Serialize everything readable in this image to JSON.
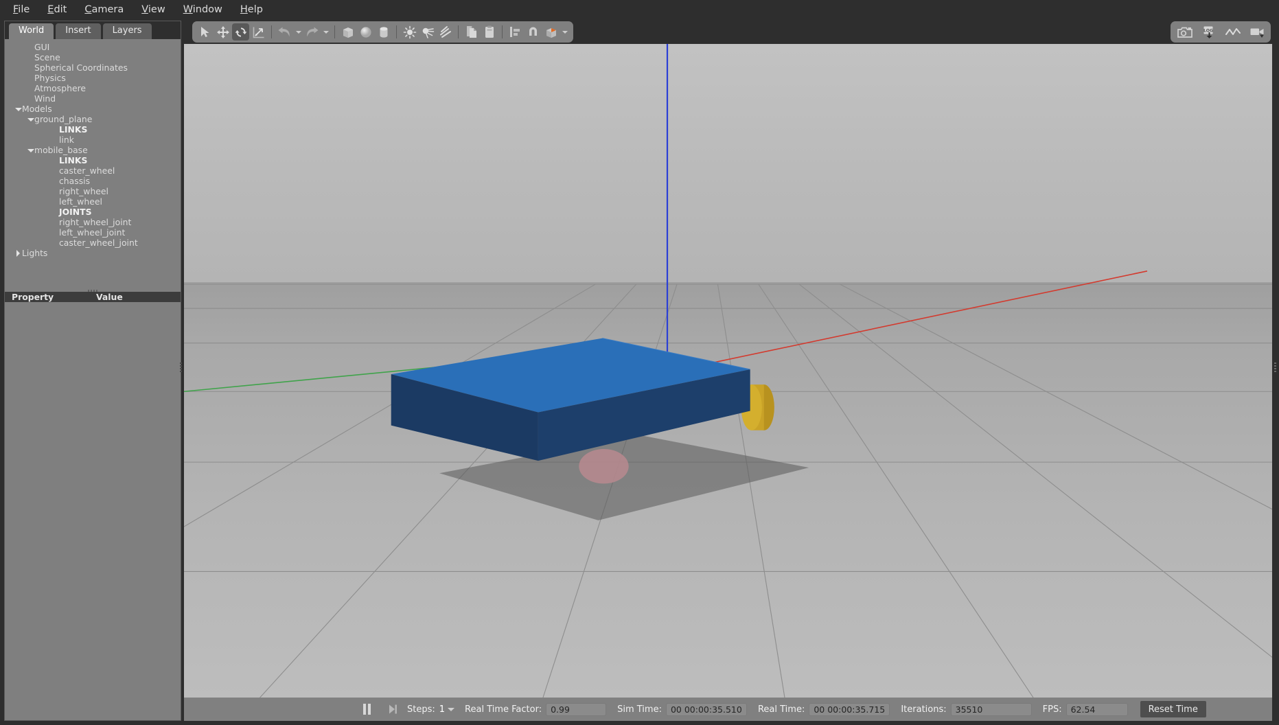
{
  "menu": {
    "items": [
      {
        "label": "File",
        "mnemonic": "F"
      },
      {
        "label": "Edit",
        "mnemonic": "E"
      },
      {
        "label": "Camera",
        "mnemonic": "C"
      },
      {
        "label": "View",
        "mnemonic": "V"
      },
      {
        "label": "Window",
        "mnemonic": "W"
      },
      {
        "label": "Help",
        "mnemonic": "H"
      }
    ]
  },
  "left_panel": {
    "tabs": [
      {
        "label": "World",
        "active": true
      },
      {
        "label": "Insert",
        "active": false
      },
      {
        "label": "Layers",
        "active": false
      }
    ],
    "tree": [
      {
        "label": "GUI",
        "indent": 1,
        "caret": "none",
        "bold": false
      },
      {
        "label": "Scene",
        "indent": 1,
        "caret": "none",
        "bold": false
      },
      {
        "label": "Spherical Coordinates",
        "indent": 1,
        "caret": "none",
        "bold": false
      },
      {
        "label": "Physics",
        "indent": 1,
        "caret": "none",
        "bold": false
      },
      {
        "label": "Atmosphere",
        "indent": 1,
        "caret": "none",
        "bold": false
      },
      {
        "label": "Wind",
        "indent": 1,
        "caret": "none",
        "bold": false
      },
      {
        "label": "Models",
        "indent": 0,
        "caret": "down",
        "bold": false
      },
      {
        "label": "ground_plane",
        "indent": 1,
        "caret": "down",
        "bold": false
      },
      {
        "label": "LINKS",
        "indent": 3,
        "caret": "none",
        "bold": true
      },
      {
        "label": "link",
        "indent": 3,
        "caret": "none",
        "bold": false
      },
      {
        "label": "mobile_base",
        "indent": 1,
        "caret": "down",
        "bold": false
      },
      {
        "label": "LINKS",
        "indent": 3,
        "caret": "none",
        "bold": true
      },
      {
        "label": "caster_wheel",
        "indent": 3,
        "caret": "none",
        "bold": false
      },
      {
        "label": "chassis",
        "indent": 3,
        "caret": "none",
        "bold": false
      },
      {
        "label": "right_wheel",
        "indent": 3,
        "caret": "none",
        "bold": false
      },
      {
        "label": "left_wheel",
        "indent": 3,
        "caret": "none",
        "bold": false
      },
      {
        "label": "JOINTS",
        "indent": 3,
        "caret": "none",
        "bold": true
      },
      {
        "label": "right_wheel_joint",
        "indent": 3,
        "caret": "none",
        "bold": false
      },
      {
        "label": "left_wheel_joint",
        "indent": 3,
        "caret": "none",
        "bold": false
      },
      {
        "label": "caster_wheel_joint",
        "indent": 3,
        "caret": "none",
        "bold": false
      },
      {
        "label": "Lights",
        "indent": 0,
        "caret": "right",
        "bold": false
      }
    ],
    "property_header": {
      "col1": "Property",
      "col2": "Value"
    }
  },
  "toolbar": {
    "left_tools": [
      {
        "name": "select-mode",
        "icon": "cursor-arrow-icon",
        "active": false
      },
      {
        "name": "translate-mode",
        "icon": "translate-arrows-icon",
        "active": false
      },
      {
        "name": "rotate-mode",
        "icon": "rotate-arrows-icon",
        "active": true
      },
      {
        "name": "scale-mode",
        "icon": "scale-arrows-icon",
        "active": false
      }
    ],
    "history_tools": [
      {
        "name": "undo-button",
        "icon": "undo-arrow-icon"
      },
      {
        "name": "undo-dropdown",
        "icon": "chevron-down-icon"
      },
      {
        "name": "redo-button",
        "icon": "redo-arrow-icon"
      },
      {
        "name": "redo-dropdown",
        "icon": "chevron-down-icon"
      }
    ],
    "shape_tools": [
      {
        "name": "insert-box",
        "icon": "box-icon"
      },
      {
        "name": "insert-sphere",
        "icon": "sphere-icon"
      },
      {
        "name": "insert-cylinder",
        "icon": "cylinder-icon"
      }
    ],
    "light_tools": [
      {
        "name": "insert-point-light",
        "icon": "point-light-icon"
      },
      {
        "name": "insert-spot-light",
        "icon": "spot-light-icon"
      },
      {
        "name": "insert-directional-light",
        "icon": "directional-light-icon"
      }
    ],
    "clipboard_tools": [
      {
        "name": "copy-button",
        "icon": "copy-icon"
      },
      {
        "name": "paste-button",
        "icon": "paste-icon"
      }
    ],
    "align_tools": [
      {
        "name": "align-button",
        "icon": "align-icon"
      },
      {
        "name": "snap-button",
        "icon": "magnet-snap-icon"
      },
      {
        "name": "view-angle-button",
        "icon": "view-cube-icon"
      },
      {
        "name": "view-angle-dropdown",
        "icon": "chevron-down-icon"
      }
    ],
    "right_tools": [
      {
        "name": "screenshot-button",
        "icon": "camera-icon"
      },
      {
        "name": "log-button",
        "icon": "log-download-icon"
      },
      {
        "name": "plot-button",
        "icon": "line-chart-icon"
      },
      {
        "name": "video-record-button",
        "icon": "video-camera-icon"
      }
    ]
  },
  "statusbar": {
    "pause_button": "pause-icon",
    "step_button": "step-forward-icon",
    "steps_label": "Steps:",
    "steps_value": "1",
    "real_time_factor_label": "Real Time Factor:",
    "real_time_factor_value": "0.99",
    "sim_time_label": "Sim Time:",
    "sim_time_value": "00 00:00:35.510",
    "real_time_label": "Real Time:",
    "real_time_value": "00 00:00:35.715",
    "iterations_label": "Iterations:",
    "iterations_value": "35510",
    "fps_label": "FPS:",
    "fps_value": "62.54",
    "reset_time_label": "Reset Time"
  },
  "scene": {
    "colors": {
      "chassis_top": "#2a6fb8",
      "chassis_front": "#1d3f6b",
      "chassis_side": "#1b3a63",
      "wheel": "#c9a227",
      "caster": "#b8898f",
      "axis_x": "#d33a2e",
      "axis_y": "#3fa34a",
      "axis_z": "#2b3fd6",
      "ground_near": "#bdbdbd",
      "ground_far": "#9f9f9f",
      "sky": "#c2c2c2",
      "grid_line": "#8f8f8f",
      "shadow": "#4a4a4a"
    },
    "objects": [
      "mobile_base chassis",
      "right_wheel",
      "left_wheel",
      "caster_wheel",
      "ground_plane grid"
    ]
  }
}
